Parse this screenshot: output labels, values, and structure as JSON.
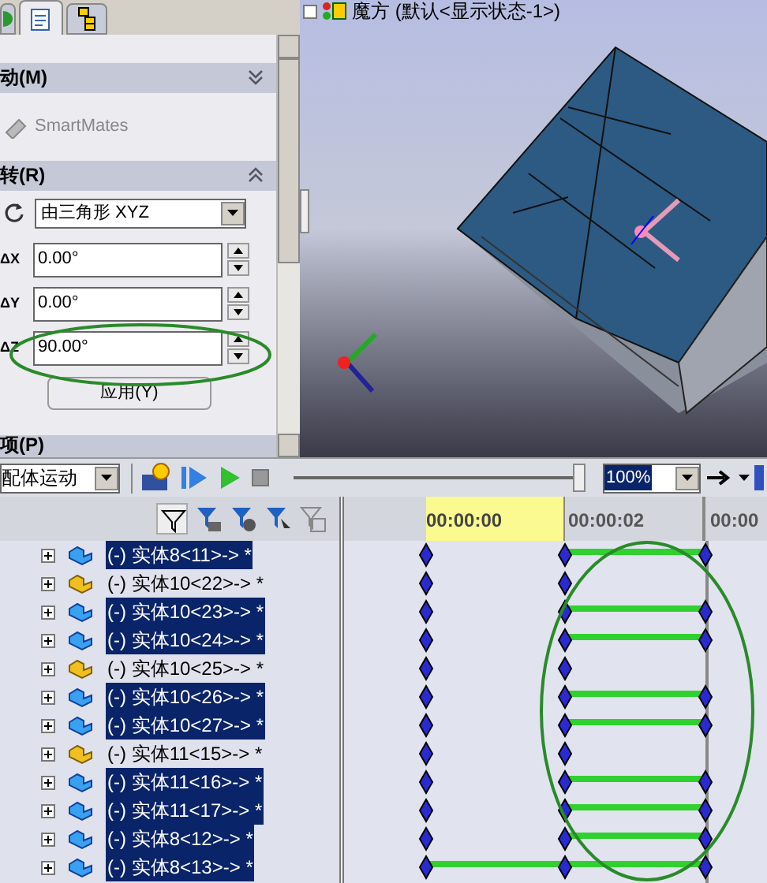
{
  "property_panel": {
    "tabs": [
      {
        "selected": false
      },
      {
        "selected": true
      },
      {
        "selected": false
      }
    ],
    "sections": [
      {
        "title": "动(M)",
        "expanded": false
      },
      {
        "title": "转(R)",
        "expanded": true
      }
    ],
    "smartmates": "SmartMates",
    "rotate_mode": "由三角形 XYZ",
    "fields": [
      {
        "label": "ΔX",
        "value": "0.00°"
      },
      {
        "label": "ΔY",
        "value": "0.00°"
      },
      {
        "label": "ΔZ",
        "value": "90.00°"
      }
    ],
    "apply_button": "应用(Y)",
    "bottom_section": "项(P)"
  },
  "viewport": {
    "title": "魔方 (默认<显示状态-1>)"
  },
  "motion_toolbar": {
    "study_type": "配体运动",
    "slider": {
      "level": 1
    },
    "zoom": "100%"
  },
  "timeline": {
    "times": [
      "00:00:00",
      "00:00:02",
      "00:00"
    ],
    "rows": [
      {
        "label": "(-) 实体8<11>-> *",
        "selected": true,
        "moving": true,
        "from_start": false
      },
      {
        "label": "(-) 实体10<22>-> *",
        "selected": false,
        "moving": false,
        "from_start": false
      },
      {
        "label": "(-) 实体10<23>-> *",
        "selected": true,
        "moving": true,
        "from_start": false
      },
      {
        "label": "(-) 实体10<24>-> *",
        "selected": true,
        "moving": true,
        "from_start": false
      },
      {
        "label": "(-) 实体10<25>-> *",
        "selected": false,
        "moving": false,
        "from_start": false
      },
      {
        "label": "(-) 实体10<26>-> *",
        "selected": true,
        "moving": true,
        "from_start": false
      },
      {
        "label": "(-) 实体10<27>-> *",
        "selected": true,
        "moving": true,
        "from_start": false
      },
      {
        "label": "(-) 实体11<15>-> *",
        "selected": false,
        "moving": false,
        "from_start": false
      },
      {
        "label": "(-) 实体11<16>-> *",
        "selected": true,
        "moving": true,
        "from_start": false
      },
      {
        "label": "(-) 实体11<17>-> *",
        "selected": true,
        "moving": true,
        "from_start": false
      },
      {
        "label": "(-) 实体8<12>-> *",
        "selected": true,
        "moving": true,
        "from_start": false
      },
      {
        "label": "(-) 实体8<13>-> *",
        "selected": true,
        "moving": true,
        "from_start": true
      }
    ]
  }
}
